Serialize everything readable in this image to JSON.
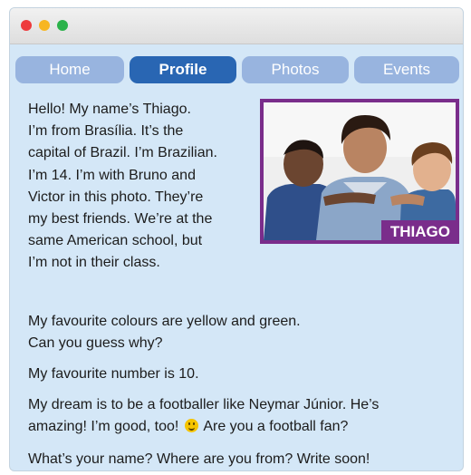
{
  "tabs": [
    {
      "label": "Home",
      "active": false
    },
    {
      "label": "Profile",
      "active": true
    },
    {
      "label": "Photos",
      "active": false
    },
    {
      "label": "Events",
      "active": false
    }
  ],
  "photo": {
    "caption": "THIAGO"
  },
  "intro_lines": [
    "Hello! My name’s Thiago.",
    "I’m from Brasília. It’s the",
    "capital of Brazil. I’m Brazilian.",
    "I’m 14. I’m with Bruno and",
    "Victor in this photo. They’re",
    "my best friends. We’re at the",
    "same American school, but",
    "I’m not in their class."
  ],
  "paragraphs": {
    "colours_line1": "My favourite colours are yellow and green.",
    "colours_line2": "Can you guess why?",
    "number": "My favourite number is 10.",
    "dream_line1": "My dream is to be a footballer like Neymar Júnior. He’s",
    "dream_line2_a": "amazing! I’m good, too!",
    "dream_line2_b": "Are you a football fan?",
    "closing": "What’s your name? Where are you from? Write soon!"
  },
  "colors": {
    "window_bg": "#d4e7f7",
    "tab_active": "#2966b3",
    "tab_inactive": "#98b4df",
    "photo_frame": "#7a2d8b"
  }
}
